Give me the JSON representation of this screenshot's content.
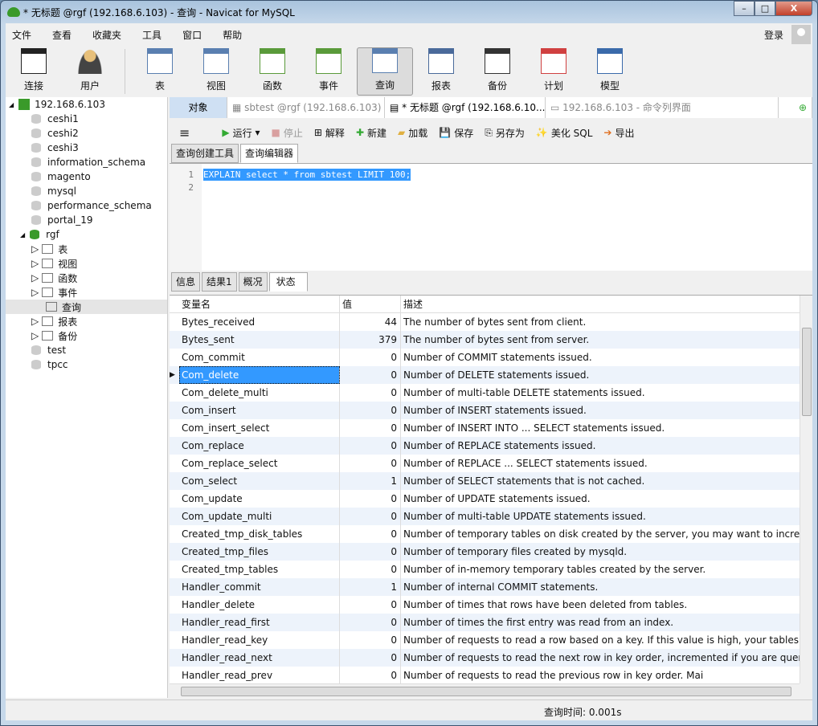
{
  "window": {
    "title": "* 无标题 @rgf (192.168.6.103) - 查询 - Navicat for MySQL",
    "min": "–",
    "max": "□",
    "close": "X"
  },
  "menu": [
    "文件",
    "查看",
    "收藏夹",
    "工具",
    "窗口",
    "帮助"
  ],
  "login": "登录",
  "toolbar": [
    "连接",
    "用户",
    "表",
    "视图",
    "函数",
    "事件",
    "查询",
    "报表",
    "备份",
    "计划",
    "模型"
  ],
  "tree": {
    "server": "192.168.6.103",
    "dbs": [
      "ceshi1",
      "ceshi2",
      "ceshi3",
      "information_schema",
      "magento",
      "mysql",
      "performance_schema",
      "portal_19",
      "rgf"
    ],
    "rgf_children": [
      "表",
      "视图",
      "函数",
      "事件",
      "查询",
      "报表",
      "备份"
    ],
    "dbs_after": [
      "test",
      "tpcc"
    ]
  },
  "tabs": {
    "object": "对象",
    "t1": "sbtest @rgf (192.168.6.103) ...",
    "t2": "* 无标题 @rgf (192.168.6.10...",
    "t3": "192.168.6.103 - 命令列界面"
  },
  "query_toolbar": {
    "run": "运行",
    "stop": "停止",
    "explain": "解释",
    "new": "新建",
    "load": "加载",
    "save": "保存",
    "saveas": "另存为",
    "beautify": "美化 SQL",
    "export": "导出"
  },
  "subtabs": [
    "查询创建工具",
    "查询编辑器"
  ],
  "editor": {
    "lines": [
      "1",
      "2"
    ],
    "code": "EXPLAIN select * from sbtest LIMIT 100;"
  },
  "result_tabs": [
    "信息",
    "结果1",
    "概况",
    "状态"
  ],
  "grid": {
    "headers": [
      "变量名",
      "值",
      "描述"
    ],
    "selected_row": 3,
    "rows": [
      [
        "Bytes_received",
        "44",
        "The number of bytes sent from client."
      ],
      [
        "Bytes_sent",
        "379",
        "The number of bytes sent from server."
      ],
      [
        "Com_commit",
        "0",
        "Number of COMMIT statements issued."
      ],
      [
        "Com_delete",
        "0",
        "Number of DELETE statements issued."
      ],
      [
        "Com_delete_multi",
        "0",
        "Number of multi-table DELETE statements issued."
      ],
      [
        "Com_insert",
        "0",
        "Number of INSERT statements issued."
      ],
      [
        "Com_insert_select",
        "0",
        "Number of INSERT INTO ... SELECT statements issued."
      ],
      [
        "Com_replace",
        "0",
        "Number of REPLACE statements issued."
      ],
      [
        "Com_replace_select",
        "0",
        "Number of REPLACE ... SELECT statements issued."
      ],
      [
        "Com_select",
        "1",
        "Number of SELECT statements that is not cached."
      ],
      [
        "Com_update",
        "0",
        "Number of UPDATE statements issued."
      ],
      [
        "Com_update_multi",
        "0",
        "Number of multi-table UPDATE statements issued."
      ],
      [
        "Created_tmp_disk_tables",
        "0",
        "Number of temporary tables on disk created by the server, you may want to increase"
      ],
      [
        "Created_tmp_files",
        "0",
        "Number of temporary files created by mysqld."
      ],
      [
        "Created_tmp_tables",
        "0",
        "Number of in-memory temporary tables created by the server."
      ],
      [
        "Handler_commit",
        "1",
        "Number of internal COMMIT statements."
      ],
      [
        "Handler_delete",
        "0",
        "Number of times that rows have been deleted from tables."
      ],
      [
        "Handler_read_first",
        "0",
        "Number of times the first entry was read from an index."
      ],
      [
        "Handler_read_key",
        "0",
        "Number of requests to read a row based on a key. If this value is high, your tables r"
      ],
      [
        "Handler_read_next",
        "0",
        "Number of requests to read the next row in key order, incremented if you are query"
      ],
      [
        "Handler_read_prev",
        "0",
        "Number of requests to read the previous row in key order. Mai"
      ]
    ]
  },
  "status": {
    "query_time": "查询时间: 0.001s"
  }
}
